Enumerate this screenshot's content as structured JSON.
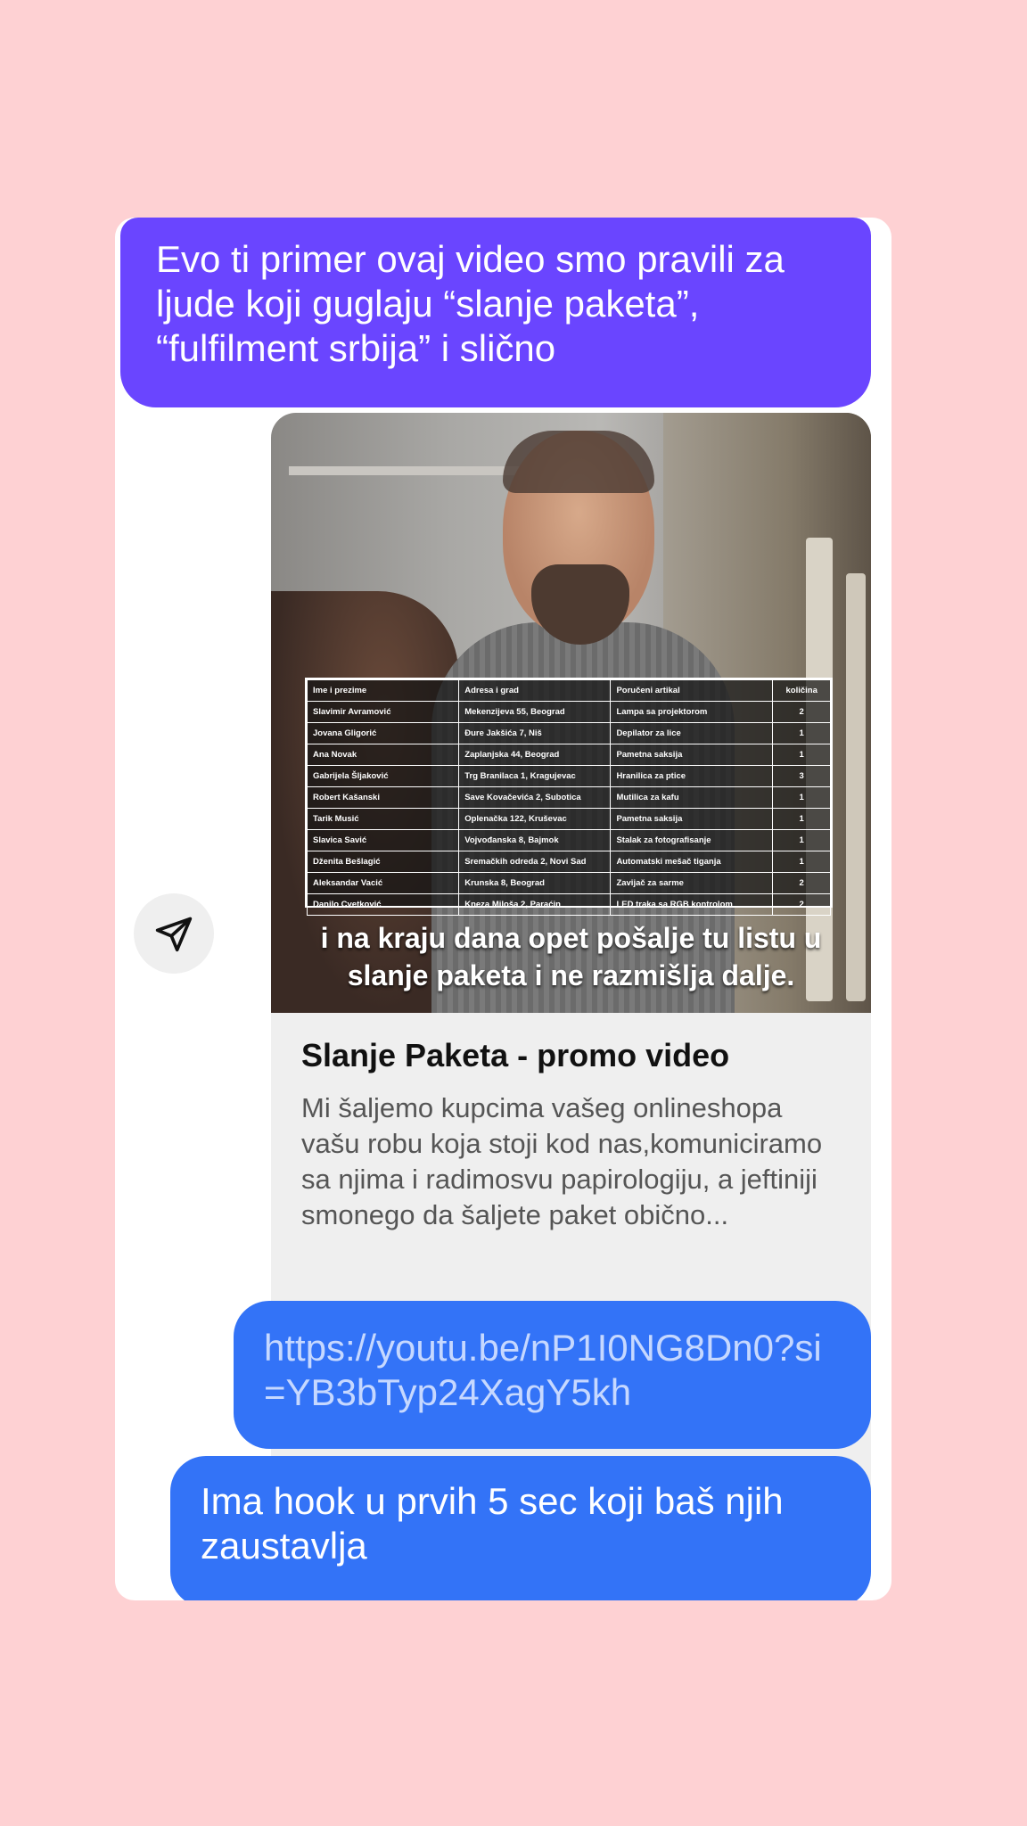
{
  "messages": {
    "received_1": "Evo ti primer ovaj video smo pravili za ljude koji guglaju “slanje paketa”, “fulfilment srbija” i slično",
    "link": "https://youtu.be/nP1I0NG8Dn0?si=YB3bTyp24XagY5kh",
    "sent_2": "Ima hook u prvih 5 sec koji baš njih zaustavlja"
  },
  "share_button": {
    "icon": "paper-plane-icon"
  },
  "preview": {
    "title": "Slanje Paketa - promo video",
    "description": "Mi šaljemo kupcima vašeg onlineshopa vašu robu koja stoji kod nas,komuniciramo sa njima i radimosvu papirologiju, a jeftiniji smonego da šaljete paket obično...",
    "caption_line1": "i na kraju dana opet pošalje tu listu u",
    "caption_line2": "slanje paketa i ne razmišlja dalje.",
    "table": {
      "headers": [
        "Ime i prezime",
        "Adresa i grad",
        "Poručeni artikal",
        "količina"
      ],
      "rows": [
        [
          "Slavimir Avramović",
          "Mekenzijeva 55, Beograd",
          "Lampa sa projektorom",
          "2"
        ],
        [
          "Jovana Gligorić",
          "Đure Jakšića 7, Niš",
          "Depilator za lice",
          "1"
        ],
        [
          "Ana Novak",
          "Zaplanjska 44, Beograd",
          "Pametna saksija",
          "1"
        ],
        [
          "Gabrijela Šljaković",
          "Trg Branilaca 1, Kragujevac",
          "Hranilica za ptice",
          "3"
        ],
        [
          "Robert Kašanski",
          "Save Kovačevića 2, Subotica",
          "Mutilica za kafu",
          "1"
        ],
        [
          "Tarik Musić",
          "Oplenačka 122, Kruševac",
          "Pametna saksija",
          "1"
        ],
        [
          "Slavica Savić",
          "Vojvođanska 8, Bajmok",
          "Stalak za fotografisanje",
          "1"
        ],
        [
          "Dženita Bešlagić",
          "Sremačkih odreda 2, Novi Sad",
          "Automatski mešač tiganja",
          "1"
        ],
        [
          "Aleksandar Vacić",
          "Krunska 8, Beograd",
          "Zavijač za sarme",
          "2"
        ],
        [
          "Danilo Cvetković",
          "Kneza Miloša 2, Paraćin",
          "LED traka sa RGB kontrolom",
          "2"
        ]
      ]
    }
  },
  "colors": {
    "background": "#fed1d3",
    "received_bubble": "#6a45ff",
    "sent_bubble": "#3373f7",
    "link_text": "#c6d8ff"
  }
}
